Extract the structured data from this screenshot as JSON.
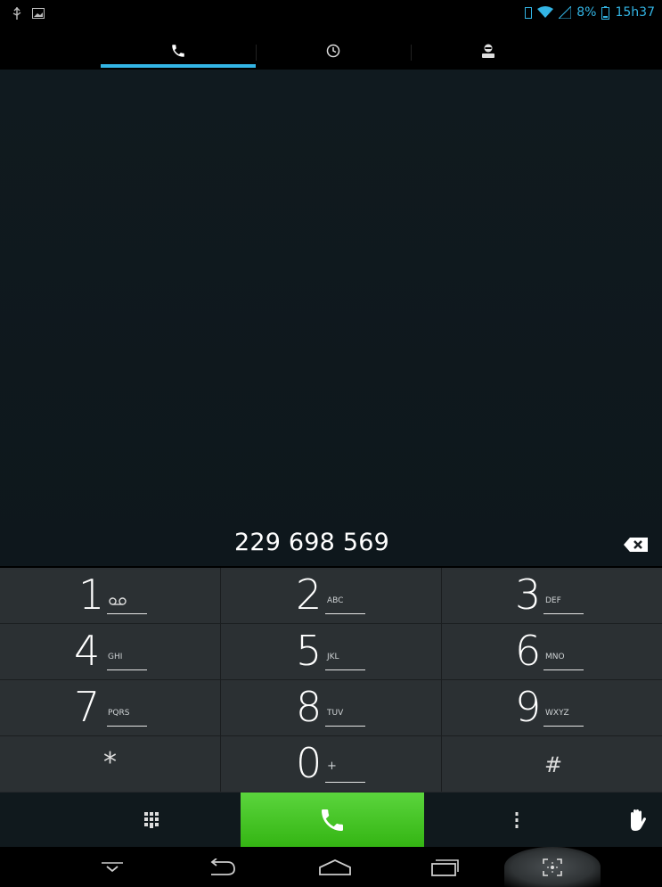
{
  "status_bar": {
    "battery_text": "8%",
    "time": "15h37",
    "accent_color": "#33b5e5"
  },
  "tabs": [
    {
      "name": "phone",
      "icon": "phone-icon",
      "selected": true
    },
    {
      "name": "call-log",
      "icon": "clock-icon",
      "selected": false
    },
    {
      "name": "contacts",
      "icon": "contact-icon",
      "selected": false
    }
  ],
  "dialer": {
    "entered_number": "229 698 569"
  },
  "keypad": {
    "rows": [
      [
        {
          "digit": "1",
          "letters": ""
        },
        {
          "digit": "2",
          "letters": "ABC"
        },
        {
          "digit": "3",
          "letters": "DEF"
        }
      ],
      [
        {
          "digit": "4",
          "letters": "GHI"
        },
        {
          "digit": "5",
          "letters": "JKL"
        },
        {
          "digit": "6",
          "letters": "MNO"
        }
      ],
      [
        {
          "digit": "7",
          "letters": "PQRS"
        },
        {
          "digit": "8",
          "letters": "TUV"
        },
        {
          "digit": "9",
          "letters": "WXYZ"
        }
      ],
      [
        {
          "digit": "*",
          "letters": ""
        },
        {
          "digit": "0",
          "letters": "+"
        },
        {
          "digit": "#",
          "letters": ""
        }
      ]
    ]
  },
  "actions": {
    "call_color": "#44c524"
  }
}
